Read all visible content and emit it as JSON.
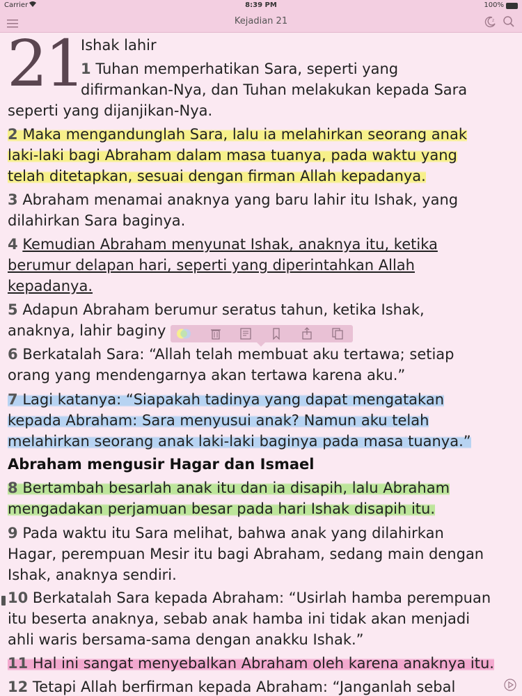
{
  "status_bar": {
    "carrier": "Carrier",
    "time": "8:39 PM",
    "battery": "100%"
  },
  "nav": {
    "title": "Kejadian 21"
  },
  "chapter": {
    "number": "21",
    "heading": "Ishak lahir"
  },
  "verses": {
    "v1_num": "1",
    "v1_l1": "Tuhan memperhatikan Sara, seperti yang",
    "v1_l2": "difirmankan-Nya, dan Tuhan melakukan kepada Sara",
    "v1_l3": "seperti yang dijanjikan-Nya.",
    "v2_num": "2",
    "v2_l1": "Maka mengandunglah Sara, lalu ia melahirkan seorang anak",
    "v2_l2": "laki-laki bagi Abraham dalam masa tuanya, pada waktu yang",
    "v2_l3": "telah ditetapkan, sesuai dengan firman Allah kepadanya.",
    "v3_num": "3",
    "v3_l1": "Abraham menamai anaknya yang baru lahir itu Ishak, yang",
    "v3_l2": "dilahirkan Sara baginya.",
    "v4_num": "4",
    "v4_l1": "Kemudian Abraham menyunat Ishak, anaknya itu, ketika",
    "v4_l2": "berumur delapan hari, seperti yang diperintahkan Allah",
    "v4_l3": "kepadanya.",
    "v5_num": "5",
    "v5_l1": "Adapun Abraham berumur seratus tahun, ketika Ishak,",
    "v5_l2": "anaknya, lahir baginy",
    "v6_num": "6",
    "v6_l1": "Berkatalah Sara: “Allah telah membuat aku tertawa; setiap",
    "v6_l2": "orang yang mendengarnya akan tertawa karena aku.”",
    "v7_num": "7",
    "v7_l1": "Lagi katanya: “Siapakah tadinya yang dapat mengatakan",
    "v7_l2": "kepada Abraham: Sara menyusui anak? Namun aku telah",
    "v7_l3": "melahirkan seorang anak laki-laki baginya pada masa tuanya.”",
    "section2": "Abraham mengusir Hagar dan Ismael",
    "v8_num": "8",
    "v8_l1": "Bertambah besarlah anak itu dan ia disapih, lalu Abraham",
    "v8_l2": "mengadakan perjamuan besar pada hari Ishak disapih itu.",
    "v9_num": "9",
    "v9_l1": "Pada waktu itu Sara melihat, bahwa anak yang dilahirkan",
    "v9_l2": "Hagar, perempuan Mesir itu bagi Abraham, sedang main dengan",
    "v9_l3": "Ishak, anaknya sendiri.",
    "v10_num": "10",
    "v10_l1": "Berkatalah Sara kepada Abraham: “Usirlah hamba perempuan",
    "v10_l2": "itu beserta anaknya, sebab anak hamba ini tidak akan menjadi",
    "v10_l3": "ahli waris bersama-sama dengan anakku Ishak.”",
    "v11_num": "11",
    "v11_l1": "Hal ini sangat menyebalkan Abraham oleh karena anaknya itu.",
    "v12_num": "12",
    "v12_l1": "Tetapi Allah berfirman kepada Abraham: “Janganlah sebal"
  },
  "toolbar": {
    "buttons": [
      "color-highlight-icon",
      "trash-icon",
      "note-icon",
      "bookmark-icon",
      "share-icon",
      "copy-icon"
    ]
  },
  "colors": {
    "background": "#fbe9f2",
    "bar": "#f3cfe1",
    "highlight_yellow": "#f7f08a",
    "highlight_blue": "#b7d3f2",
    "highlight_green": "#bde59b",
    "highlight_pink": "#f3a9cf"
  }
}
